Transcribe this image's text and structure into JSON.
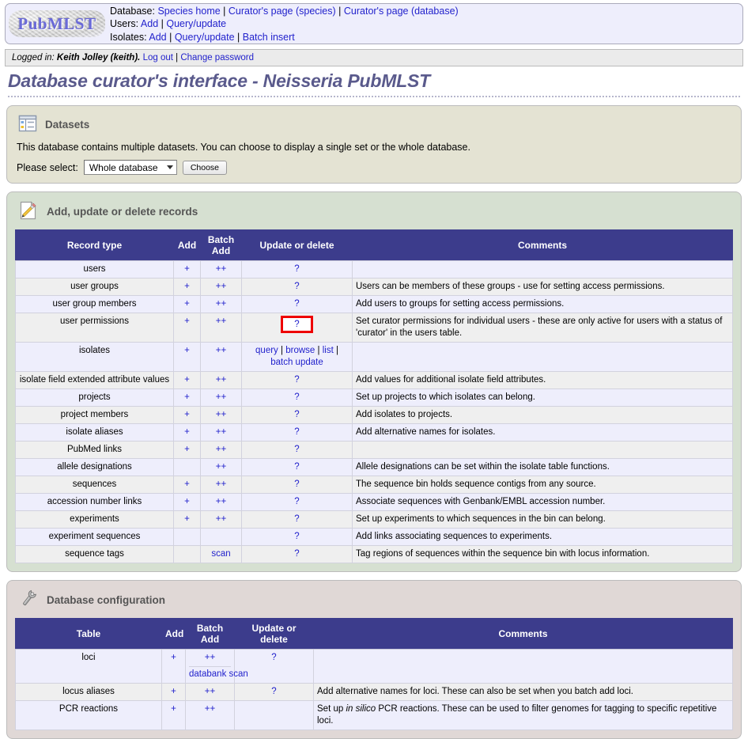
{
  "header": {
    "logo_text": "PubMLST",
    "lines": [
      {
        "label": "Database:",
        "links": [
          "Species home",
          "Curator's page (species)",
          "Curator's page (database)"
        ]
      },
      {
        "label": "Users:",
        "links": [
          "Add",
          "Query/update"
        ]
      },
      {
        "label": "Isolates:",
        "links": [
          "Add",
          "Query/update",
          "Batch insert"
        ]
      }
    ]
  },
  "session": {
    "prefix": "Logged in:",
    "user": "Keith Jolley (keith).",
    "logout": "Log out",
    "change_password": "Change password"
  },
  "page_title": "Database curator's interface - Neisseria PubMLST",
  "datasets": {
    "icon": "datasets-icon",
    "heading": "Datasets",
    "description": "This database contains multiple datasets. You can choose to display a single set or the whole database.",
    "select_label": "Please select:",
    "select_value": "Whole database",
    "select_options": [
      "Whole database"
    ],
    "choose_label": "Choose"
  },
  "records": {
    "icon": "pencil-icon",
    "heading": "Add, update or delete records",
    "columns": [
      "Record type",
      "Add",
      "Batch Add",
      "Update or delete",
      "Comments"
    ],
    "column_lines": {
      "batch": [
        "Batch",
        "Add"
      ]
    },
    "rows": [
      {
        "name": "users",
        "add": "+",
        "batch": "++",
        "update": "?",
        "comment": ""
      },
      {
        "name": "user groups",
        "add": "+",
        "batch": "++",
        "update": "?",
        "comment": "Users can be members of these groups - use for setting access permissions."
      },
      {
        "name": "user group members",
        "add": "+",
        "batch": "++",
        "update": "?",
        "comment": "Add users to groups for setting access permissions."
      },
      {
        "name": "user permissions",
        "add": "+",
        "batch": "++",
        "update": "?",
        "highlight": true,
        "comment": "Set curator permissions for individual users - these are only active for users with a status of 'curator' in the users table."
      },
      {
        "name": "isolates",
        "add": "+",
        "batch": "++",
        "update_links": [
          "query",
          "browse",
          "list",
          "batch update"
        ],
        "comment": ""
      },
      {
        "name": "isolate field extended attribute values",
        "add": "+",
        "batch": "++",
        "update": "?",
        "comment": "Add values for additional isolate field attributes."
      },
      {
        "name": "projects",
        "add": "+",
        "batch": "++",
        "update": "?",
        "comment": "Set up projects to which isolates can belong."
      },
      {
        "name": "project members",
        "add": "+",
        "batch": "++",
        "update": "?",
        "comment": "Add isolates to projects."
      },
      {
        "name": "isolate aliases",
        "add": "+",
        "batch": "++",
        "update": "?",
        "comment": "Add alternative names for isolates."
      },
      {
        "name": "PubMed links",
        "add": "+",
        "batch": "++",
        "update": "?",
        "comment": ""
      },
      {
        "name": "allele designations",
        "add": "",
        "batch": "++",
        "update": "?",
        "comment": "Allele designations can be set within the isolate table functions."
      },
      {
        "name": "sequences",
        "add": "+",
        "batch": "++",
        "update": "?",
        "comment": "The sequence bin holds sequence contigs from any source."
      },
      {
        "name": "accession number links",
        "add": "+",
        "batch": "++",
        "update": "?",
        "comment": "Associate sequences with Genbank/EMBL accession number."
      },
      {
        "name": "experiments",
        "add": "+",
        "batch": "++",
        "update": "?",
        "comment": "Set up experiments to which sequences in the bin can belong."
      },
      {
        "name": "experiment sequences",
        "add": "",
        "batch": "",
        "update": "?",
        "comment": "Add links associating sequences to experiments."
      },
      {
        "name": "sequence tags",
        "add": "",
        "batch": "scan",
        "update": "?",
        "comment": "Tag regions of sequences within the sequence bin with locus information."
      }
    ]
  },
  "config": {
    "icon": "wrench-icon",
    "heading": "Database configuration",
    "columns": [
      "Table",
      "Add",
      "Batch Add",
      "Update or delete",
      "Comments"
    ],
    "rows": [
      {
        "name": "loci",
        "add": "+",
        "batch": "++",
        "update": "?",
        "extra_link": "databank scan",
        "comment": ""
      },
      {
        "name": "locus aliases",
        "add": "+",
        "batch": "++",
        "update": "?",
        "comment": "Add alternative names for loci. These can also be set when you batch add loci."
      },
      {
        "name": "PCR reactions",
        "add": "+",
        "batch": "++",
        "update": "",
        "comment_html": "Set up <i>in silico</i> PCR reactions. These can be used to filter genomes for tagging to specific repetitive loci."
      }
    ]
  },
  "colors": {
    "table_header": "#3c3c8c",
    "link": "#2222cc",
    "highlight": "#ee0000",
    "title": "#5a5a8c",
    "panel_datasets": "#e4e3d3",
    "panel_records": "#d6e0d1",
    "panel_config": "#e0d8d6"
  }
}
